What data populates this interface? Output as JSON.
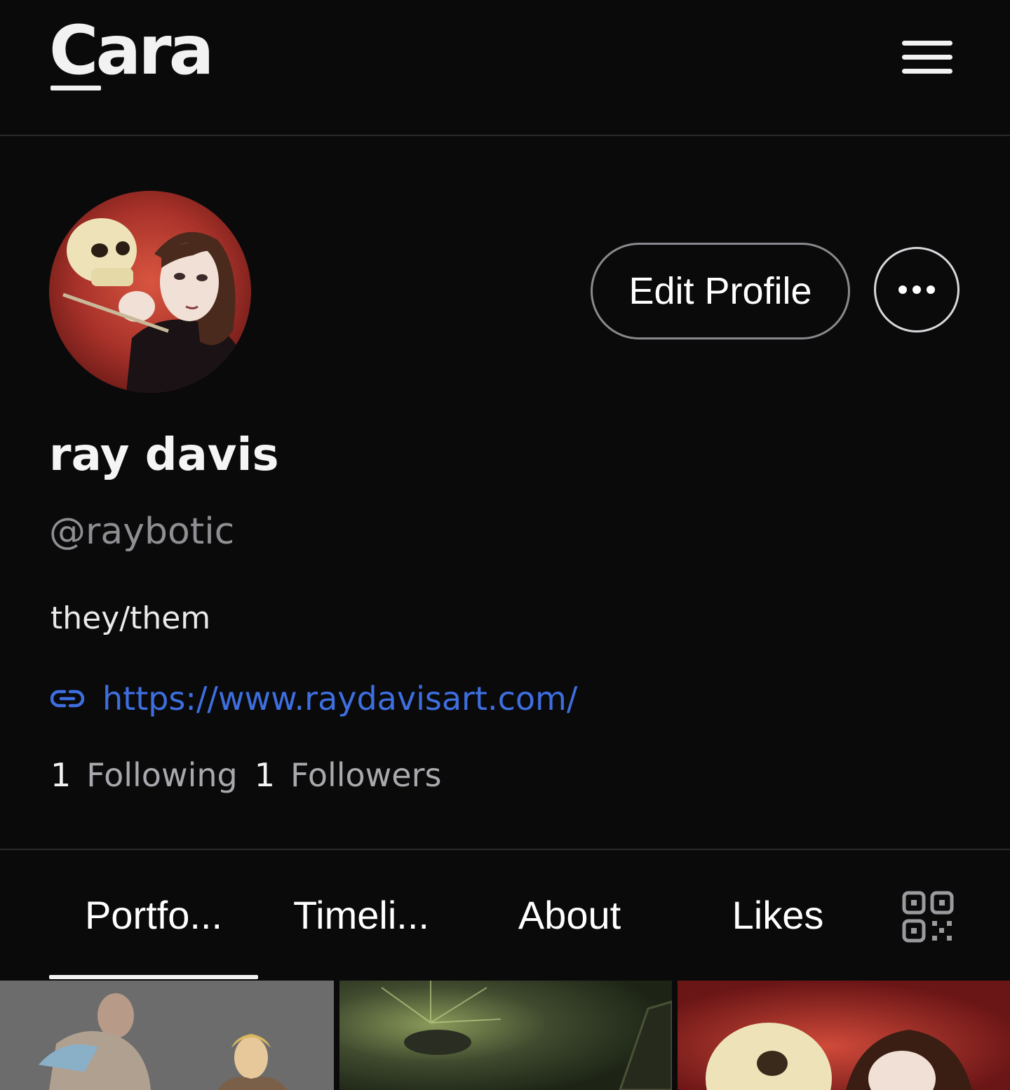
{
  "header": {
    "logo_text": "Cara",
    "menu_icon": "hamburger-menu-icon"
  },
  "profile": {
    "display_name": "ray davis",
    "handle": "@raybotic",
    "bio": "they/them",
    "link_icon": "link-icon",
    "link": "https://www.raydavisart.com/",
    "edit_profile_label": "Edit Profile",
    "more_icon": "more-horizontal-icon",
    "following_count": "1",
    "following_label": "Following",
    "followers_count": "1",
    "followers_label": "Followers"
  },
  "tabs": [
    {
      "label": "Portfo...",
      "active": true
    },
    {
      "label": "Timeli...",
      "active": false
    },
    {
      "label": "About",
      "active": false
    },
    {
      "label": "Likes",
      "active": false
    }
  ],
  "qr_icon": "qr-code-icon",
  "colors": {
    "background": "#0a0a0b",
    "link": "#3e6fe0",
    "muted_text": "#8e8e93"
  }
}
